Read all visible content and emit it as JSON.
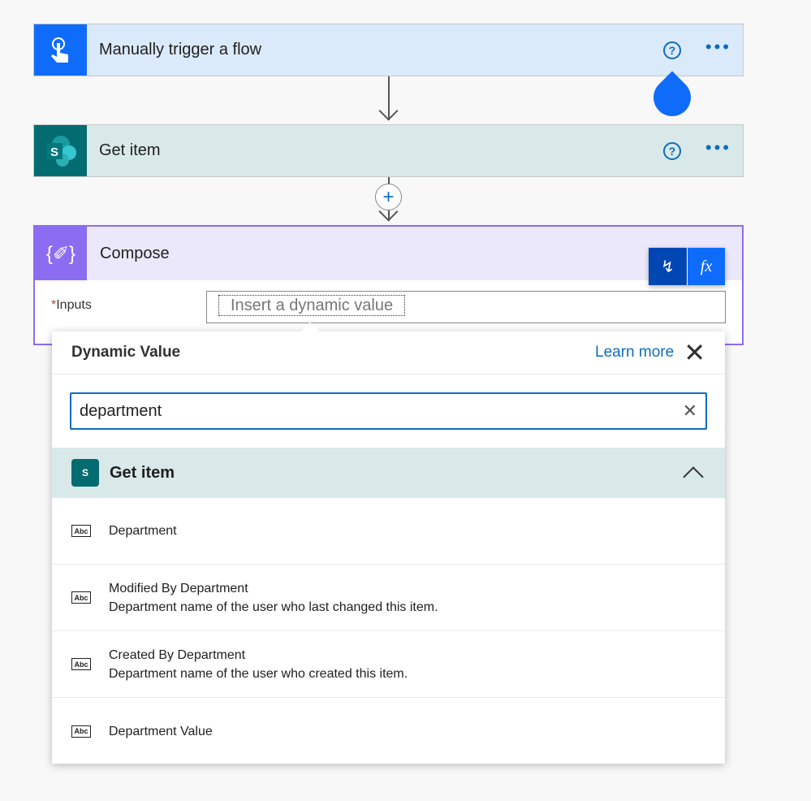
{
  "steps": [
    {
      "title": "Manually trigger a flow",
      "color": "#0f6cfa",
      "bg": "#dbeafb"
    },
    {
      "title": "Get item",
      "color": "#036c70",
      "bg": "#d9e8e8"
    },
    {
      "title": "Compose",
      "color": "#8c6cf0",
      "bg": "#ece8fc"
    }
  ],
  "compose": {
    "inputs_label": "Inputs",
    "required_mark": "*",
    "placeholder": "Insert a dynamic value"
  },
  "panel": {
    "title": "Dynamic Value",
    "learn_more": "Learn more",
    "search_value": "department",
    "group": "Get item",
    "items": [
      {
        "title": "Department",
        "desc": ""
      },
      {
        "title": "Modified By Department",
        "desc": "Department name of the user who last changed this item."
      },
      {
        "title": "Created By Department",
        "desc": "Department name of the user who created this item."
      },
      {
        "title": "Department Value",
        "desc": ""
      }
    ],
    "type_icon": "Abc"
  },
  "toolbar": {
    "fx_label": "fx"
  },
  "icons": {
    "help": "?",
    "more": "•••"
  }
}
